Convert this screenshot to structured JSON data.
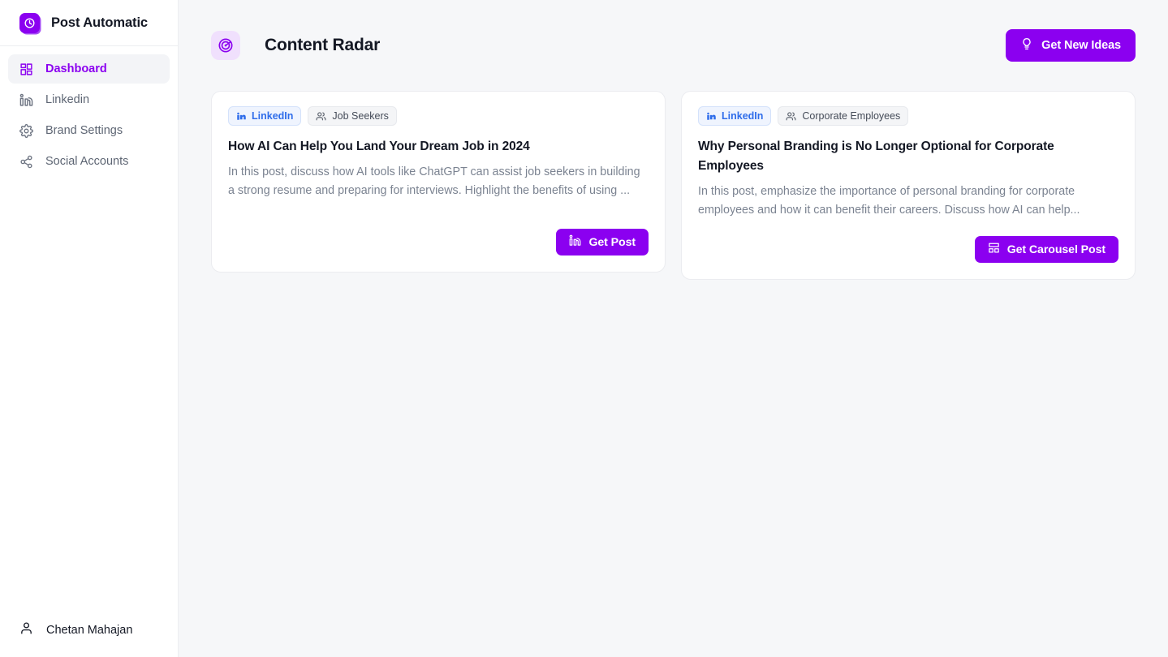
{
  "brand": {
    "name": "Post Automatic",
    "logo_icon": "clock-stack-icon",
    "accent_color": "#8B00F0"
  },
  "sidebar": {
    "items": [
      {
        "label": "Dashboard",
        "icon": "grid-dashboard-icon",
        "active": true
      },
      {
        "label": "Linkedin",
        "icon": "linkedin-icon",
        "active": false
      },
      {
        "label": "Brand Settings",
        "icon": "gear-icon",
        "active": false
      },
      {
        "label": "Social Accounts",
        "icon": "share-nodes-icon",
        "active": false
      }
    ],
    "footer": {
      "user_name": "Chetan Mahajan",
      "icon": "user-icon"
    }
  },
  "header": {
    "title": "Content Radar",
    "title_icon": "radar-icon",
    "action": {
      "label": "Get New Ideas",
      "icon": "lightbulb-icon",
      "color": "#8B00F0"
    }
  },
  "main": {
    "cards": [
      {
        "platform_badge": {
          "label": "LinkedIn",
          "icon": "linkedin-icon",
          "color": "#2f6dea"
        },
        "audience_badge": {
          "label": "Job Seekers",
          "icon": "users-icon"
        },
        "title": "How AI Can Help You Land Your Dream Job in 2024",
        "description": "In this post, discuss how AI tools like ChatGPT can assist job seekers in building a strong resume and preparing for interviews. Highlight the benefits of using ...",
        "action": {
          "label": "Get Post",
          "icon": "linkedin-icon"
        }
      },
      {
        "platform_badge": {
          "label": "LinkedIn",
          "icon": "linkedin-icon",
          "color": "#2f6dea"
        },
        "audience_badge": {
          "label": "Corporate Employees",
          "icon": "users-icon"
        },
        "title": "Why Personal Branding is No Longer Optional for Corporate Employees",
        "description": "In this post, emphasize the importance of personal branding for corporate employees and how it can benefit their careers. Discuss how AI can help...",
        "action": {
          "label": "Get Carousel Post",
          "icon": "carousel-layout-icon"
        }
      }
    ]
  }
}
